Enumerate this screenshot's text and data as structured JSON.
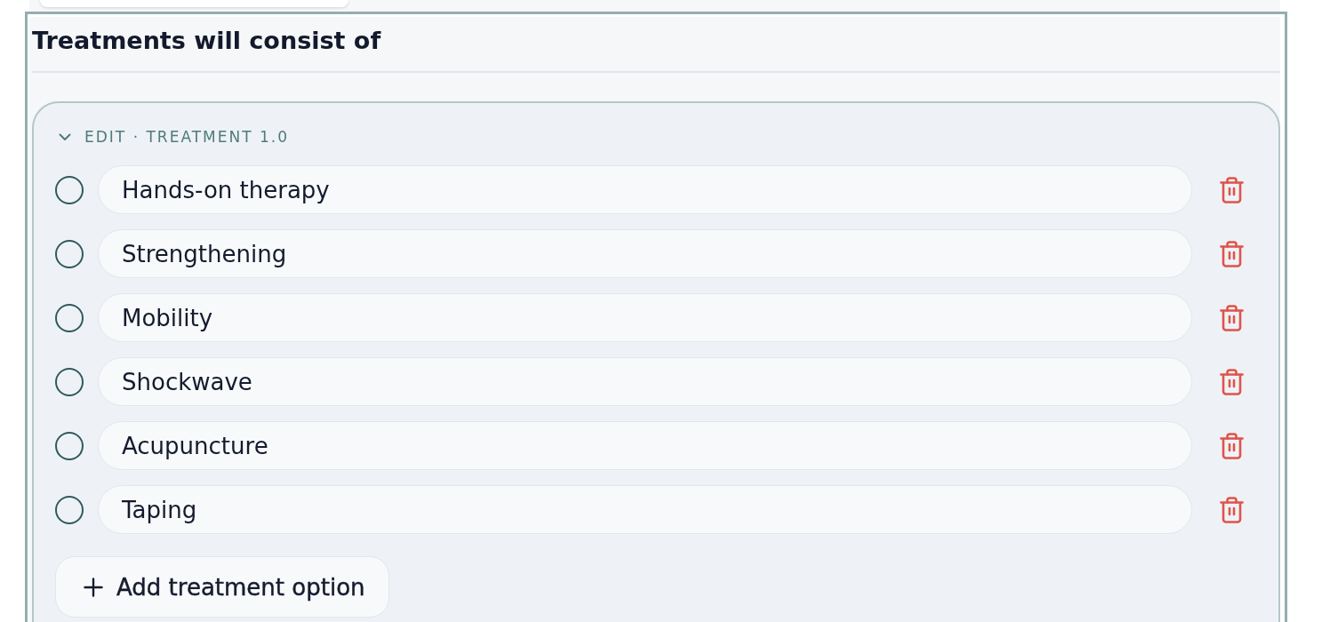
{
  "section": {
    "title": "Treatments will consist of"
  },
  "treatment": {
    "label": "EDIT · TREATMENT 1.0",
    "expanded": true,
    "options": [
      {
        "text": "Hands-on therapy",
        "selected": false
      },
      {
        "text": "Strengthening",
        "selected": false
      },
      {
        "text": "Mobility",
        "selected": false
      },
      {
        "text": "Shockwave",
        "selected": false
      },
      {
        "text": "Acupuncture",
        "selected": false
      },
      {
        "text": "Taping",
        "selected": false
      }
    ],
    "add_button": {
      "label": "Add treatment option"
    }
  }
}
